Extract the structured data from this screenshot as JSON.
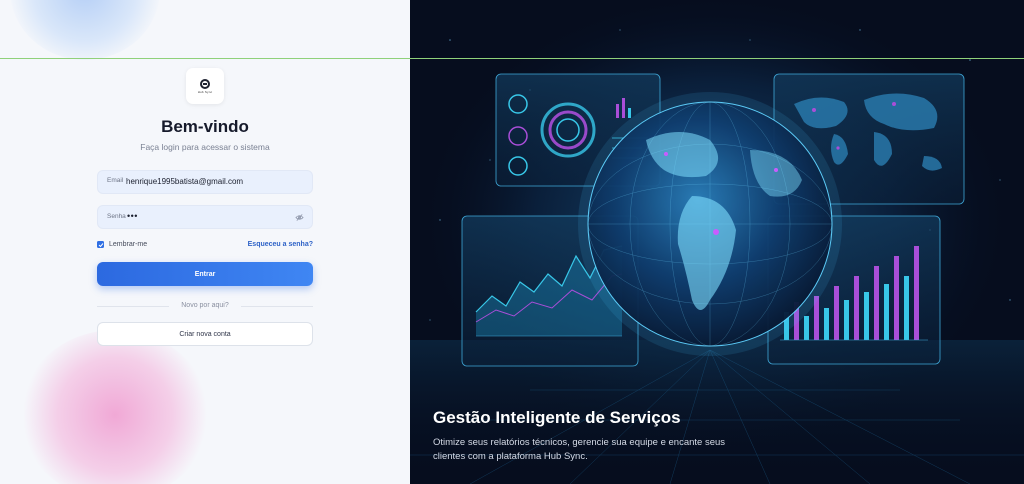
{
  "brand": {
    "logo_icon": "hub-sync-logo",
    "logo_caption": "Hub Sync"
  },
  "login": {
    "title": "Bem-vindo",
    "subtitle": "Faça login para acessar o sistema",
    "email_label": "Email",
    "email_value": "henrique1995batista@gmail.com",
    "password_label": "Senha",
    "password_value": "•••",
    "remember_label": "Lembrar-me",
    "remember_checked": true,
    "forgot_link": "Esqueceu a senha?",
    "submit_label": "Entrar",
    "divider_text": "Novo por aqui?",
    "create_account_label": "Criar nova conta"
  },
  "hero": {
    "title": "Gestão Inteligente de Serviços",
    "description": "Otimize seus relatórios técnicos, gerencie sua equipe e encante seus clientes com a plataforma Hub Sync."
  },
  "colors": {
    "primary": "#2f6fe4",
    "hero_background": "#060d1e",
    "accent_cyan": "#38c7e8",
    "accent_purple": "#a94ed8"
  }
}
